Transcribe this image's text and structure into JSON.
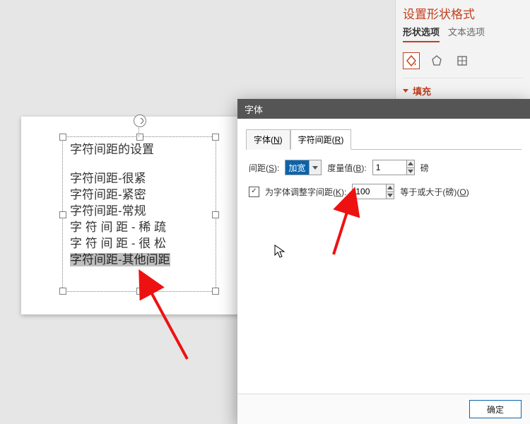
{
  "format_pane": {
    "title": "设置形状格式",
    "tab_shape": "形状选项",
    "tab_text": "文本选项",
    "section_fill": "填充"
  },
  "textbox": {
    "title": "字符间距的设置",
    "lines": [
      "字符间距-很紧",
      "字符间距-紧密",
      "字符间距-常规",
      "字 符 间 距 - 稀 疏",
      "字 符 间 距 - 很 松",
      "字符间距-其他间距"
    ]
  },
  "dialog": {
    "title": "字体",
    "tab_font": "字体(<u>N</u>)",
    "tab_font_plain": "字体(N)",
    "tab_spacing": "字符间距(<u>R</u>)",
    "tab_spacing_plain": "字符间距(R)",
    "spacing_label": "间距(<u>S</u>):",
    "spacing_label_plain": "间距(S):",
    "spacing_value": "加宽",
    "metric_label": "度量值(<u>B</u>):",
    "metric_label_plain": "度量值(B):",
    "metric_value": "1",
    "metric_unit": "磅",
    "kerning_label": "为字体调整字间距(<u>K</u>):",
    "kerning_label_plain": "为字体调整字间距(K):",
    "kerning_value": "100",
    "kerning_tail": "等于或大于(磅)(<u>O</u>)",
    "kerning_tail_plain": "等于或大于(磅)(O)",
    "ok": "确定"
  }
}
